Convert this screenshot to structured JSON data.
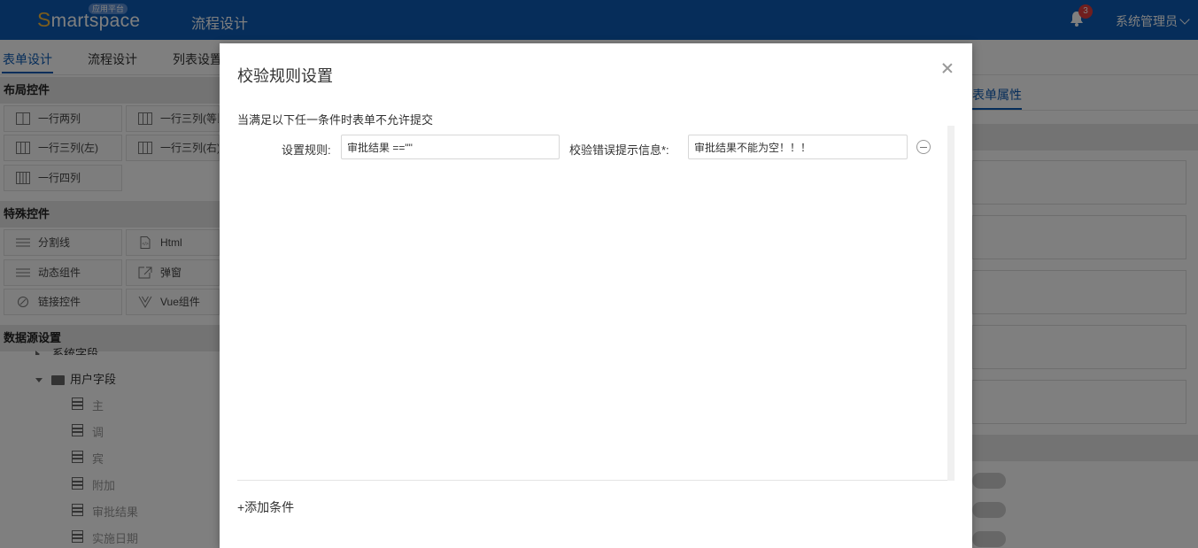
{
  "app": {
    "logo_s": "S",
    "logo_rest": "martspace",
    "logo_badge": "应用平台",
    "title": "流程设计",
    "notification_count": "3",
    "user_name": "系统管理员"
  },
  "tabs": [
    {
      "label": "表单设计",
      "active": true
    },
    {
      "label": "流程设计",
      "active": false
    },
    {
      "label": "列表设置",
      "active": false
    }
  ],
  "left_panel": {
    "layout_title": "布局控件",
    "layout_items": [
      "一行两列",
      "一行三列(等比",
      "一行三列(左)",
      "一行三列(右)",
      "一行四列"
    ],
    "special_title": "特殊控件",
    "special_items": [
      "分割线",
      "Html",
      "动态组件",
      "弹窗",
      "链接控件",
      "Vue组件"
    ],
    "datasource_title": "数据源设置",
    "tree_system": "系统字段",
    "tree_user": "用户字段",
    "user_fields": [
      "主",
      "调",
      "宾",
      "附加",
      "审批结果",
      "实施日期"
    ]
  },
  "right_panel": {
    "tab_label": "表单属性"
  },
  "modal": {
    "title": "校验规则设置",
    "hint": "当满足以下任一条件时表单不允许提交",
    "rule_label": "设置规则:",
    "rule_value": "审批结果 ==\"\"",
    "error_label": "校验错误提示信息*:",
    "error_value": "审批结果不能为空！！！",
    "add_condition": "+添加条件"
  },
  "colors": {
    "brand_blue": "#0c5bb5",
    "logo_gold": "#f6b93b",
    "badge_red": "#e03c3c"
  }
}
